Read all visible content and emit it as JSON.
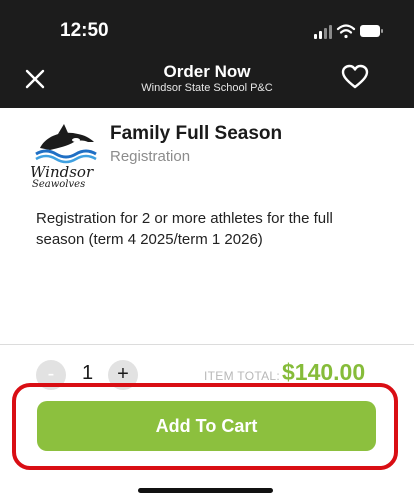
{
  "status_bar": {
    "time": "12:50"
  },
  "nav": {
    "title": "Order Now",
    "subtitle": "Windsor State School P&C"
  },
  "product": {
    "logo_text": "Windsor Seawolves",
    "title": "Family Full Season",
    "category": "Registration",
    "description": "Registration for 2 or more athletes for the full season (term 4 2025/term 1 2026)"
  },
  "order": {
    "minus_label": "-",
    "quantity": "1",
    "plus_label": "+",
    "total_label": "ITEM TOTAL:",
    "total_value": "$140.00",
    "add_to_cart_label": "Add To Cart"
  },
  "colors": {
    "accent": "#8cc03e",
    "price": "#86bc3a",
    "highlight": "#d90e14",
    "header": "#1c1c1c"
  }
}
